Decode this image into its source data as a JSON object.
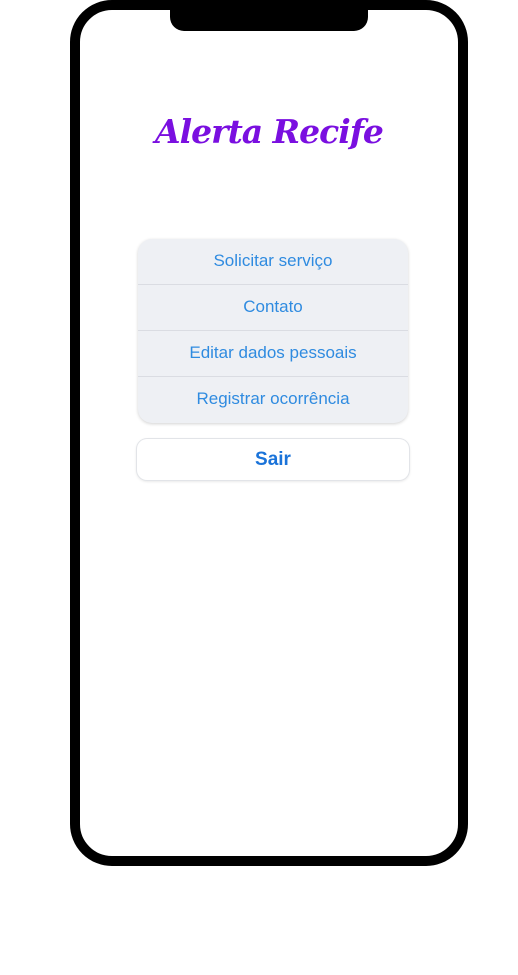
{
  "app": {
    "title": "Alerta Recife"
  },
  "menu": {
    "items": [
      {
        "label": "Solicitar serviço"
      },
      {
        "label": "Contato"
      },
      {
        "label": "Editar dados pessoais"
      },
      {
        "label": "Registrar ocorrência"
      }
    ]
  },
  "logout": {
    "label": "Sair"
  },
  "colors": {
    "title": "#7a0fe0",
    "menu_text": "#2f8be0",
    "logout_text": "#1a73d9",
    "menu_background": "#eef0f4"
  }
}
